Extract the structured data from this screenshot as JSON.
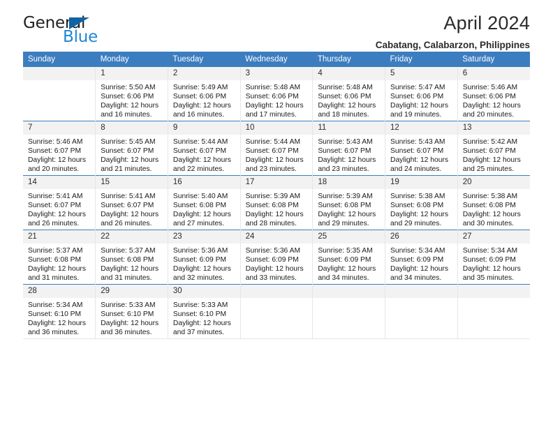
{
  "brand": {
    "name_part1": "General",
    "name_part2": "Blue",
    "triangle_icon": "triangle-icon",
    "colors": {
      "dark": "#231f20",
      "blue": "#1e87d4",
      "triangle": "#1063a5"
    }
  },
  "header": {
    "title": "April 2024",
    "subtitle": "Cabatang, Calabarzon, Philippines"
  },
  "theme": {
    "header_bg": "#3c7dc0",
    "header_text": "#ffffff",
    "daynum_bg": "#f2f2f2",
    "cell_bg": "#ffffff",
    "row_divider": "#3c7dc0",
    "col_divider": "#e6e6e6"
  },
  "calendar": {
    "columns": [
      "Sunday",
      "Monday",
      "Tuesday",
      "Wednesday",
      "Thursday",
      "Friday",
      "Saturday"
    ],
    "weeks": [
      [
        {
          "day": "",
          "blank": true,
          "sunrise": "",
          "sunset": "",
          "daylight1": "",
          "daylight2": ""
        },
        {
          "day": "1",
          "sunrise": "Sunrise: 5:50 AM",
          "sunset": "Sunset: 6:06 PM",
          "daylight1": "Daylight: 12 hours",
          "daylight2": "and 16 minutes."
        },
        {
          "day": "2",
          "sunrise": "Sunrise: 5:49 AM",
          "sunset": "Sunset: 6:06 PM",
          "daylight1": "Daylight: 12 hours",
          "daylight2": "and 16 minutes."
        },
        {
          "day": "3",
          "sunrise": "Sunrise: 5:48 AM",
          "sunset": "Sunset: 6:06 PM",
          "daylight1": "Daylight: 12 hours",
          "daylight2": "and 17 minutes."
        },
        {
          "day": "4",
          "sunrise": "Sunrise: 5:48 AM",
          "sunset": "Sunset: 6:06 PM",
          "daylight1": "Daylight: 12 hours",
          "daylight2": "and 18 minutes."
        },
        {
          "day": "5",
          "sunrise": "Sunrise: 5:47 AM",
          "sunset": "Sunset: 6:06 PM",
          "daylight1": "Daylight: 12 hours",
          "daylight2": "and 19 minutes."
        },
        {
          "day": "6",
          "sunrise": "Sunrise: 5:46 AM",
          "sunset": "Sunset: 6:06 PM",
          "daylight1": "Daylight: 12 hours",
          "daylight2": "and 20 minutes."
        }
      ],
      [
        {
          "day": "7",
          "sunrise": "Sunrise: 5:46 AM",
          "sunset": "Sunset: 6:07 PM",
          "daylight1": "Daylight: 12 hours",
          "daylight2": "and 20 minutes."
        },
        {
          "day": "8",
          "sunrise": "Sunrise: 5:45 AM",
          "sunset": "Sunset: 6:07 PM",
          "daylight1": "Daylight: 12 hours",
          "daylight2": "and 21 minutes."
        },
        {
          "day": "9",
          "sunrise": "Sunrise: 5:44 AM",
          "sunset": "Sunset: 6:07 PM",
          "daylight1": "Daylight: 12 hours",
          "daylight2": "and 22 minutes."
        },
        {
          "day": "10",
          "sunrise": "Sunrise: 5:44 AM",
          "sunset": "Sunset: 6:07 PM",
          "daylight1": "Daylight: 12 hours",
          "daylight2": "and 23 minutes."
        },
        {
          "day": "11",
          "sunrise": "Sunrise: 5:43 AM",
          "sunset": "Sunset: 6:07 PM",
          "daylight1": "Daylight: 12 hours",
          "daylight2": "and 23 minutes."
        },
        {
          "day": "12",
          "sunrise": "Sunrise: 5:43 AM",
          "sunset": "Sunset: 6:07 PM",
          "daylight1": "Daylight: 12 hours",
          "daylight2": "and 24 minutes."
        },
        {
          "day": "13",
          "sunrise": "Sunrise: 5:42 AM",
          "sunset": "Sunset: 6:07 PM",
          "daylight1": "Daylight: 12 hours",
          "daylight2": "and 25 minutes."
        }
      ],
      [
        {
          "day": "14",
          "sunrise": "Sunrise: 5:41 AM",
          "sunset": "Sunset: 6:07 PM",
          "daylight1": "Daylight: 12 hours",
          "daylight2": "and 26 minutes."
        },
        {
          "day": "15",
          "sunrise": "Sunrise: 5:41 AM",
          "sunset": "Sunset: 6:07 PM",
          "daylight1": "Daylight: 12 hours",
          "daylight2": "and 26 minutes."
        },
        {
          "day": "16",
          "sunrise": "Sunrise: 5:40 AM",
          "sunset": "Sunset: 6:08 PM",
          "daylight1": "Daylight: 12 hours",
          "daylight2": "and 27 minutes."
        },
        {
          "day": "17",
          "sunrise": "Sunrise: 5:39 AM",
          "sunset": "Sunset: 6:08 PM",
          "daylight1": "Daylight: 12 hours",
          "daylight2": "and 28 minutes."
        },
        {
          "day": "18",
          "sunrise": "Sunrise: 5:39 AM",
          "sunset": "Sunset: 6:08 PM",
          "daylight1": "Daylight: 12 hours",
          "daylight2": "and 29 minutes."
        },
        {
          "day": "19",
          "sunrise": "Sunrise: 5:38 AM",
          "sunset": "Sunset: 6:08 PM",
          "daylight1": "Daylight: 12 hours",
          "daylight2": "and 29 minutes."
        },
        {
          "day": "20",
          "sunrise": "Sunrise: 5:38 AM",
          "sunset": "Sunset: 6:08 PM",
          "daylight1": "Daylight: 12 hours",
          "daylight2": "and 30 minutes."
        }
      ],
      [
        {
          "day": "21",
          "sunrise": "Sunrise: 5:37 AM",
          "sunset": "Sunset: 6:08 PM",
          "daylight1": "Daylight: 12 hours",
          "daylight2": "and 31 minutes."
        },
        {
          "day": "22",
          "sunrise": "Sunrise: 5:37 AM",
          "sunset": "Sunset: 6:08 PM",
          "daylight1": "Daylight: 12 hours",
          "daylight2": "and 31 minutes."
        },
        {
          "day": "23",
          "sunrise": "Sunrise: 5:36 AM",
          "sunset": "Sunset: 6:09 PM",
          "daylight1": "Daylight: 12 hours",
          "daylight2": "and 32 minutes."
        },
        {
          "day": "24",
          "sunrise": "Sunrise: 5:36 AM",
          "sunset": "Sunset: 6:09 PM",
          "daylight1": "Daylight: 12 hours",
          "daylight2": "and 33 minutes."
        },
        {
          "day": "25",
          "sunrise": "Sunrise: 5:35 AM",
          "sunset": "Sunset: 6:09 PM",
          "daylight1": "Daylight: 12 hours",
          "daylight2": "and 34 minutes."
        },
        {
          "day": "26",
          "sunrise": "Sunrise: 5:34 AM",
          "sunset": "Sunset: 6:09 PM",
          "daylight1": "Daylight: 12 hours",
          "daylight2": "and 34 minutes."
        },
        {
          "day": "27",
          "sunrise": "Sunrise: 5:34 AM",
          "sunset": "Sunset: 6:09 PM",
          "daylight1": "Daylight: 12 hours",
          "daylight2": "and 35 minutes."
        }
      ],
      [
        {
          "day": "28",
          "sunrise": "Sunrise: 5:34 AM",
          "sunset": "Sunset: 6:10 PM",
          "daylight1": "Daylight: 12 hours",
          "daylight2": "and 36 minutes."
        },
        {
          "day": "29",
          "sunrise": "Sunrise: 5:33 AM",
          "sunset": "Sunset: 6:10 PM",
          "daylight1": "Daylight: 12 hours",
          "daylight2": "and 36 minutes."
        },
        {
          "day": "30",
          "sunrise": "Sunrise: 5:33 AM",
          "sunset": "Sunset: 6:10 PM",
          "daylight1": "Daylight: 12 hours",
          "daylight2": "and 37 minutes."
        },
        {
          "day": "",
          "blank": true,
          "sunrise": "",
          "sunset": "",
          "daylight1": "",
          "daylight2": ""
        },
        {
          "day": "",
          "blank": true,
          "sunrise": "",
          "sunset": "",
          "daylight1": "",
          "daylight2": ""
        },
        {
          "day": "",
          "blank": true,
          "sunrise": "",
          "sunset": "",
          "daylight1": "",
          "daylight2": ""
        },
        {
          "day": "",
          "blank": true,
          "sunrise": "",
          "sunset": "",
          "daylight1": "",
          "daylight2": ""
        }
      ]
    ]
  }
}
